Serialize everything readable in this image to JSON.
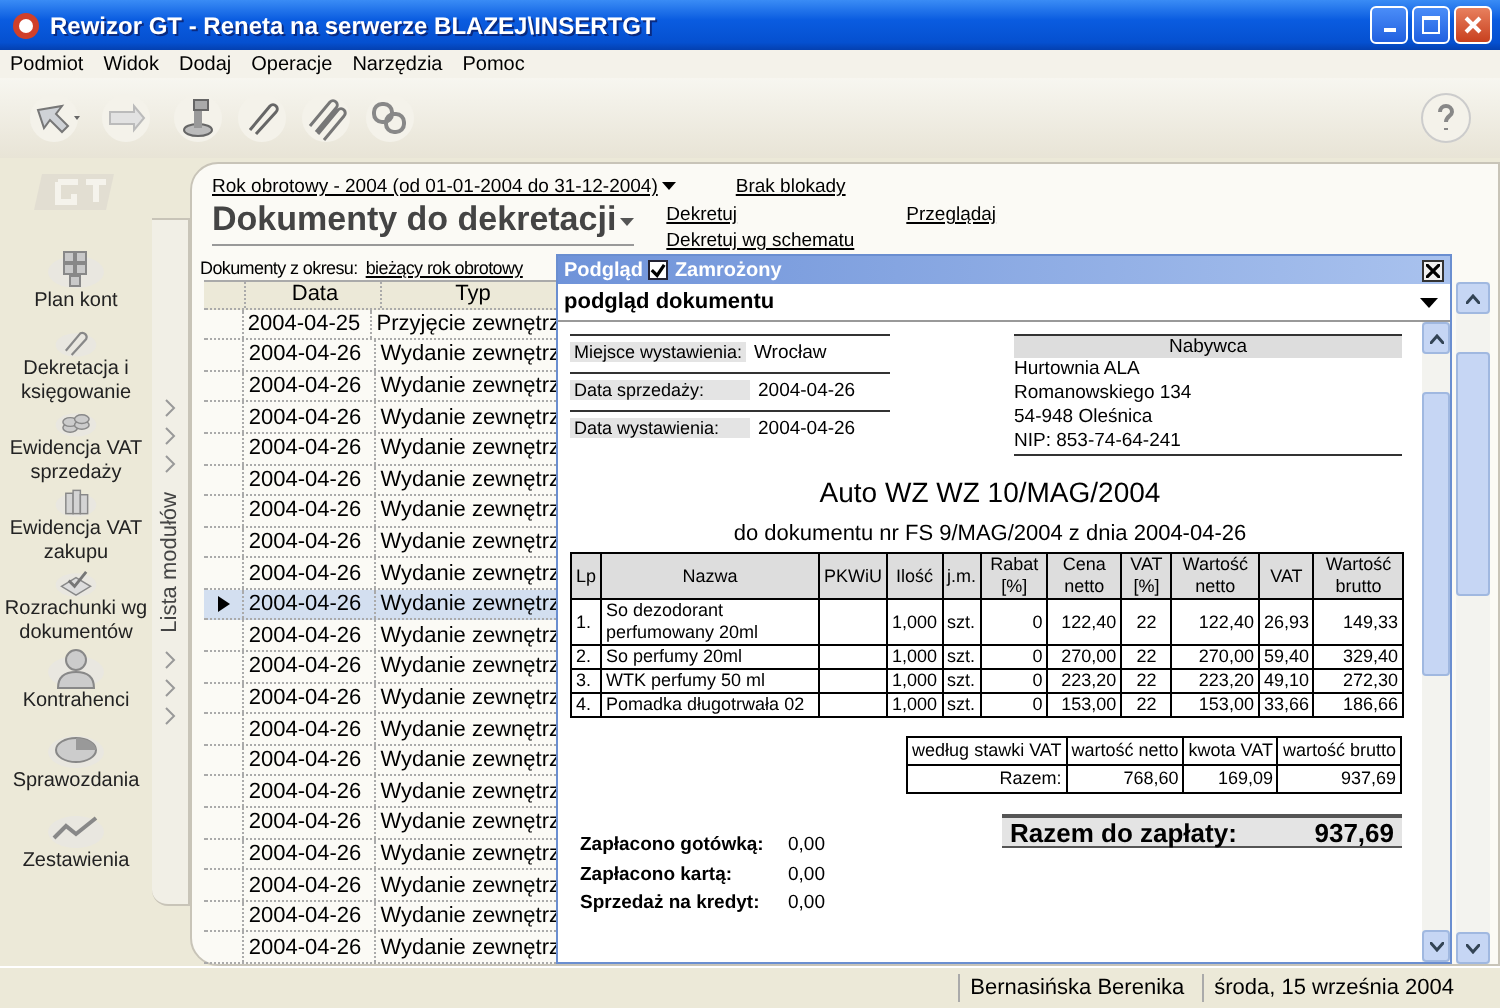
{
  "window": {
    "title": "Rewizor GT - Reneta na serwerze BLAZEJ\\INSERTGT"
  },
  "menu": [
    "Podmiot",
    "Widok",
    "Dodaj",
    "Operacje",
    "Narzędzia",
    "Pomoc"
  ],
  "sidebar": {
    "modules": [
      {
        "label": "Plan kont",
        "kind": "grid"
      },
      {
        "label": "Dekretacja i księgowanie",
        "kind": "clip"
      },
      {
        "label": "Ewidencja VAT sprzedaży",
        "kind": "coins"
      },
      {
        "label": "Ewidencja VAT zakupu",
        "kind": "books"
      },
      {
        "label": "Rozrachunki wg dokumentów",
        "kind": "check"
      },
      {
        "label": "Kontrahenci",
        "kind": "person"
      },
      {
        "label": "Sprawozdania",
        "kind": "pie"
      },
      {
        "label": "Zestawienia",
        "kind": "chart"
      }
    ],
    "strip_label": "Lista modułów"
  },
  "header": {
    "fiscal_year": "Rok obrotowy - 2004  (od 01-01-2004 do 31-12-2004)",
    "lock": "Brak blokady",
    "page_title": "Dokumenty do dekretacji",
    "actions": [
      "Dekretuj",
      "Dekretuj wg schematu",
      "Przeglądaj"
    ],
    "period_label": "Dokumenty z okresu:",
    "period": "bieżący rok obrotowy"
  },
  "table": {
    "columns": [
      "Data",
      "Typ"
    ],
    "rows": [
      {
        "date": "2004-04-25",
        "type": "Przyjęcie zewnętrz",
        "selected": false
      },
      {
        "date": "2004-04-26",
        "type": "Wydanie zewnętrz",
        "selected": false
      },
      {
        "date": "2004-04-26",
        "type": "Wydanie zewnętrz",
        "selected": false
      },
      {
        "date": "2004-04-26",
        "type": "Wydanie zewnętrz",
        "selected": false
      },
      {
        "date": "2004-04-26",
        "type": "Wydanie zewnętrz",
        "selected": false
      },
      {
        "date": "2004-04-26",
        "type": "Wydanie zewnętrz",
        "selected": false
      },
      {
        "date": "2004-04-26",
        "type": "Wydanie zewnętrz",
        "selected": false
      },
      {
        "date": "2004-04-26",
        "type": "Wydanie zewnętrz",
        "selected": false
      },
      {
        "date": "2004-04-26",
        "type": "Wydanie zewnętrz",
        "selected": false
      },
      {
        "date": "2004-04-26",
        "type": "Wydanie zewnętrz",
        "selected": true
      },
      {
        "date": "2004-04-26",
        "type": "Wydanie zewnętrz",
        "selected": false
      },
      {
        "date": "2004-04-26",
        "type": "Wydanie zewnętrz",
        "selected": false
      },
      {
        "date": "2004-04-26",
        "type": "Wydanie zewnętrz",
        "selected": false
      },
      {
        "date": "2004-04-26",
        "type": "Wydanie zewnętrz",
        "selected": false
      },
      {
        "date": "2004-04-26",
        "type": "Wydanie zewnętrz",
        "selected": false
      },
      {
        "date": "2004-04-26",
        "type": "Wydanie zewnętrz",
        "selected": false
      },
      {
        "date": "2004-04-26",
        "type": "Wydanie zewnętrz",
        "selected": false
      },
      {
        "date": "2004-04-26",
        "type": "Wydanie zewnętrz",
        "selected": false
      },
      {
        "date": "2004-04-26",
        "type": "Wydanie zewnętrz",
        "selected": false
      },
      {
        "date": "2004-04-26",
        "type": "Wydanie zewnętrz",
        "selected": false
      },
      {
        "date": "2004-04-26",
        "type": "Wydanie zewnętrz",
        "selected": false
      }
    ]
  },
  "preview": {
    "title": "Podgląd",
    "frozen": {
      "label": "Zamrożony",
      "checked": true
    },
    "view": "podgląd dokumentu",
    "document": {
      "fields": [
        {
          "label": "Miejsce wystawienia:",
          "value": "Wrocław"
        },
        {
          "label": "Data sprzedaży:",
          "value": "2004-04-26"
        },
        {
          "label": "Data wystawienia:",
          "value": "2004-04-26"
        }
      ],
      "buyer_heading": "Nabywca",
      "buyer": [
        "Hurtownia ALA",
        "Romanowskiego 134",
        "54-948 Oleśnica",
        "NIP: 853-74-64-241"
      ],
      "title": "Auto WZ WZ 10/MAG/2004",
      "subtitle": "do dokumentu nr FS 9/MAG/2004 z dnia 2004-04-26",
      "item_columns": [
        "Lp",
        "Nazwa",
        "PKWiU",
        "Ilość",
        "j.m.",
        "Rabat [%]",
        "Cena netto",
        "VAT [%]",
        "Wartość netto",
        "VAT",
        "Wartość brutto"
      ],
      "items": [
        {
          "lp": "1.",
          "name": "So dezodorant perfumowany 20ml",
          "qty": "1,000",
          "unit": "szt.",
          "discount": "0",
          "price": "122,40",
          "vat_rate": "22",
          "net": "122,40",
          "vat": "26,93",
          "gross": "149,33"
        },
        {
          "lp": "2.",
          "name": "So perfumy 20ml",
          "qty": "1,000",
          "unit": "szt.",
          "discount": "0",
          "price": "270,00",
          "vat_rate": "22",
          "net": "270,00",
          "vat": "59,40",
          "gross": "329,40"
        },
        {
          "lp": "3.",
          "name": "WTK perfumy 50 ml",
          "qty": "1,000",
          "unit": "szt.",
          "discount": "0",
          "price": "223,20",
          "vat_rate": "22",
          "net": "223,20",
          "vat": "49,10",
          "gross": "272,30"
        },
        {
          "lp": "4.",
          "name": "Pomadka długotrwała 02",
          "qty": "1,000",
          "unit": "szt.",
          "discount": "0",
          "price": "153,00",
          "vat_rate": "22",
          "net": "153,00",
          "vat": "33,66",
          "gross": "186,66"
        }
      ],
      "summary_columns": [
        "według stawki VAT",
        "wartość netto",
        "kwota VAT",
        "wartość brutto"
      ],
      "summary_row": [
        "Razem:",
        "768,60",
        "169,09",
        "937,69"
      ],
      "total_label": "Razem do zapłaty:",
      "total_value": "937,69",
      "payments": [
        {
          "label": "Zapłacono gotówką:",
          "value": "0,00"
        },
        {
          "label": "Zapłacono kartą:",
          "value": "0,00"
        },
        {
          "label": "Sprzedaż na kredyt:",
          "value": "0,00"
        }
      ]
    }
  },
  "status_bar": [
    "Bernasińska Berenika",
    "środa, 15 września 2004"
  ]
}
